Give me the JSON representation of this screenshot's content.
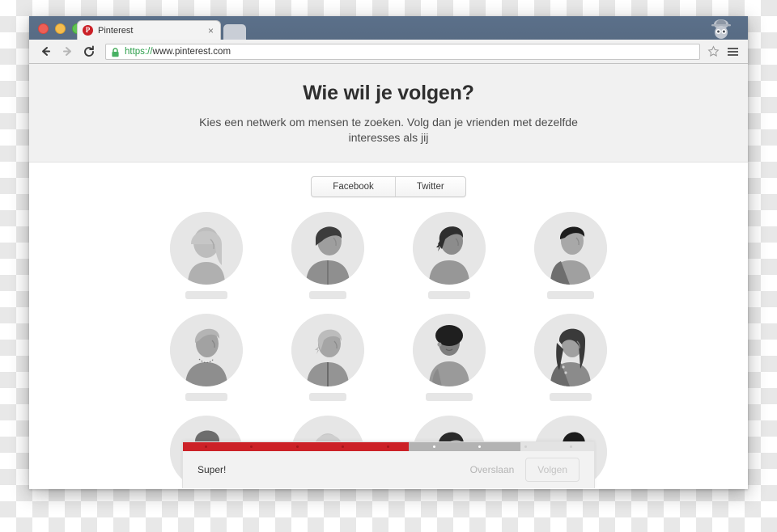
{
  "browser": {
    "traffic_lights": [
      "close",
      "minimize",
      "maximize"
    ],
    "tab": {
      "title": "Pinterest",
      "favicon_letter": "P",
      "favicon_color": "#cb2027",
      "close_glyph": "×"
    },
    "toolbar": {
      "back_glyph": "←",
      "forward_glyph": "→",
      "reload_glyph": "↻",
      "url_scheme": "https://",
      "url_host": "www.pinterest.com",
      "url_full": "https://www.pinterest.com",
      "secure": true,
      "star_glyph": "☆"
    },
    "incognito_badge": "incognito"
  },
  "page": {
    "title": "Wie wil je volgen?",
    "subtitle": "Kies een netwerk om mensen te zoeken. Volg dan je vrienden met dezelfde interesses als jij",
    "networks": [
      {
        "label": "Facebook"
      },
      {
        "label": "Twitter"
      }
    ],
    "avatars": [
      {
        "id": 1,
        "hair": "long-light",
        "tone": "light"
      },
      {
        "id": 2,
        "hair": "short-dark",
        "tone": "mid"
      },
      {
        "id": 3,
        "hair": "messy-dark",
        "tone": "dark"
      },
      {
        "id": 4,
        "hair": "crop-black",
        "tone": "mid"
      },
      {
        "id": 5,
        "hair": "swept-light",
        "tone": "light"
      },
      {
        "id": 6,
        "hair": "bob-light",
        "tone": "light"
      },
      {
        "id": 7,
        "hair": "afro-black",
        "tone": "dark"
      },
      {
        "id": 8,
        "hair": "long-dark",
        "tone": "mid"
      },
      {
        "id": 9,
        "hair": "cap-grey",
        "tone": "mid"
      },
      {
        "id": 10,
        "hair": "long-pale",
        "tone": "light"
      },
      {
        "id": 11,
        "hair": "shaggy-dark",
        "tone": "mid"
      },
      {
        "id": 12,
        "hair": "bangs-black",
        "tone": "mid"
      }
    ]
  },
  "bottom_bar": {
    "status_text": "Super!",
    "skip_label": "Overslaan",
    "follow_label": "Volgen",
    "follow_enabled": false,
    "progress": {
      "filled_percent": 55,
      "mid_percent": 27,
      "fill_color": "#cc2127",
      "mid_color": "#b3b3b3",
      "track_color": "#e3e3e3",
      "steps": [
        {
          "state": "on"
        },
        {
          "state": "on"
        },
        {
          "state": "on"
        },
        {
          "state": "on"
        },
        {
          "state": "on"
        },
        {
          "state": "mid"
        },
        {
          "state": "mid"
        },
        {
          "state": "off"
        },
        {
          "state": "off"
        }
      ]
    }
  }
}
